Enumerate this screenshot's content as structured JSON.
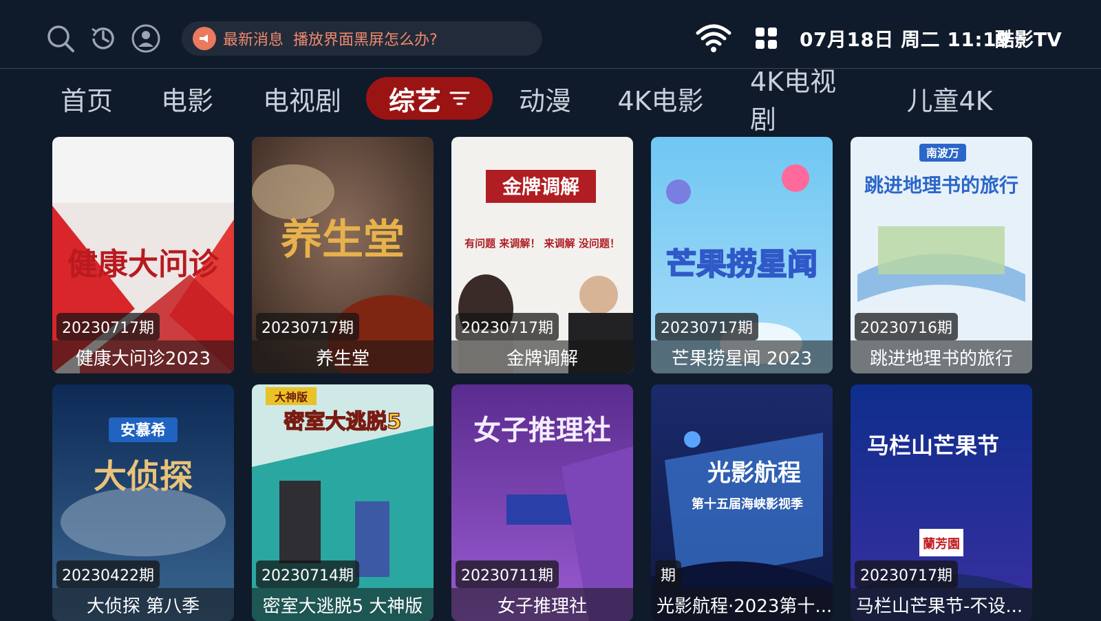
{
  "header": {
    "icons": [
      "search-icon",
      "history-icon",
      "user-icon"
    ],
    "news_label": "最新消息",
    "news_text": "播放界面黑屏怎么办?",
    "right_icons": [
      "wifi-icon",
      "apps-grid-icon"
    ],
    "datetime": "07月18日 周二 11:19",
    "brand": "酷影TV"
  },
  "tabs": [
    {
      "label": "首页"
    },
    {
      "label": "电影"
    },
    {
      "label": "电视剧"
    },
    {
      "label": "综艺",
      "active": true
    },
    {
      "label": "动漫"
    },
    {
      "label": "4K电影"
    },
    {
      "label": "4K电视剧"
    },
    {
      "label": "儿童4K"
    }
  ],
  "cards": [
    {
      "badge": "20230717期",
      "title": "健康大问诊2023",
      "poster_text": "健康大问诊"
    },
    {
      "badge": "20230717期",
      "title": "养生堂",
      "poster_text": "养生堂"
    },
    {
      "badge": "20230717期",
      "title": "金牌调解",
      "poster_text": "金牌调解",
      "poster_sub": "有问题 来调解！ 来调解 没问题！"
    },
    {
      "badge": "20230717期",
      "title": "芒果捞星闻 2023",
      "poster_text": "芒果捞星闻"
    },
    {
      "badge": "20230716期",
      "title": "跳进地理书的旅行",
      "poster_text": "跳进地理书的旅行",
      "poster_sub": "南波万"
    },
    {
      "badge": "20230422期",
      "title": "大侦探 第八季",
      "poster_text": "大侦探",
      "poster_sub": "安慕希"
    },
    {
      "badge": "20230714期",
      "title": "密室大逃脱5 大神版",
      "poster_text": "密室大逃脱5",
      "poster_sub": "大神版"
    },
    {
      "badge": "20230711期",
      "title": "女子推理社",
      "poster_text": "女子推理社"
    },
    {
      "badge": "期",
      "title": "光影航程·2023第十...",
      "poster_text": "光影航程",
      "poster_sub": "第十五届海峡影视季"
    },
    {
      "badge": "20230717期",
      "title": "马栏山芒果节-不设...",
      "poster_text": "马栏山芒果节",
      "poster_sub": "蘭芳園"
    }
  ],
  "colors": {
    "background": "#0f1a2a",
    "active_tab": "#9b1414",
    "news_accent": "#f08a6e"
  }
}
